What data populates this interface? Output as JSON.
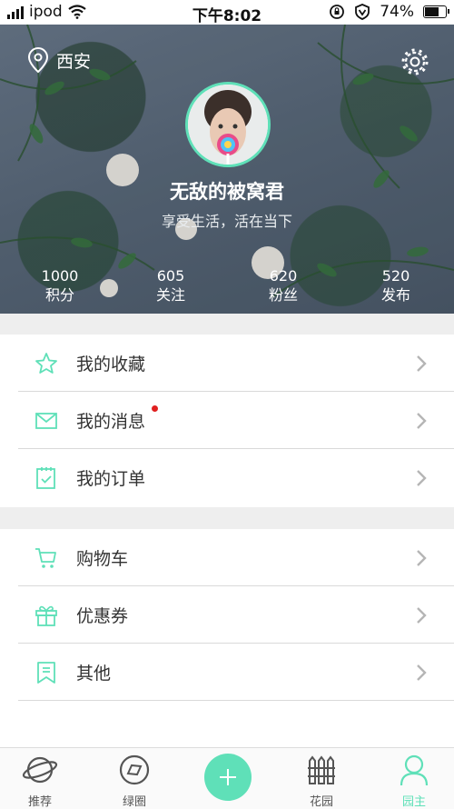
{
  "status_bar": {
    "carrier": "ipod",
    "time": "下午8:02",
    "battery": "74%",
    "battery_level": 0.74
  },
  "header": {
    "location": "西安",
    "username": "无敌的被窝君",
    "tagline": "享受生活，活在当下",
    "stats": [
      {
        "value": "1000",
        "label": "积分"
      },
      {
        "value": "605",
        "label": "关注"
      },
      {
        "value": "620",
        "label": "粉丝"
      },
      {
        "value": "520",
        "label": "发布"
      }
    ]
  },
  "menu_group_1": [
    {
      "label": "我的收藏",
      "icon": "star-icon"
    },
    {
      "label": "我的消息",
      "icon": "mail-icon",
      "unread_dot": true
    },
    {
      "label": "我的订单",
      "icon": "order-icon"
    }
  ],
  "menu_group_2": [
    {
      "label": "购物车",
      "icon": "cart-icon"
    },
    {
      "label": "优惠券",
      "icon": "gift-icon"
    },
    {
      "label": "其他",
      "icon": "bookmark-icon"
    }
  ],
  "tabbar": {
    "tabs": [
      {
        "label": "推荐",
        "icon": "planet-icon"
      },
      {
        "label": "绿圈",
        "icon": "compass-icon"
      },
      {
        "label": "",
        "icon": "plus-icon"
      },
      {
        "label": "花园",
        "icon": "fence-icon"
      },
      {
        "label": "园主",
        "icon": "user-icon",
        "active": true
      }
    ]
  },
  "colors": {
    "accent": "#5fe0b8",
    "badge": "#e02020",
    "divider": "#d9d9d9",
    "gap": "#eeeeee"
  }
}
